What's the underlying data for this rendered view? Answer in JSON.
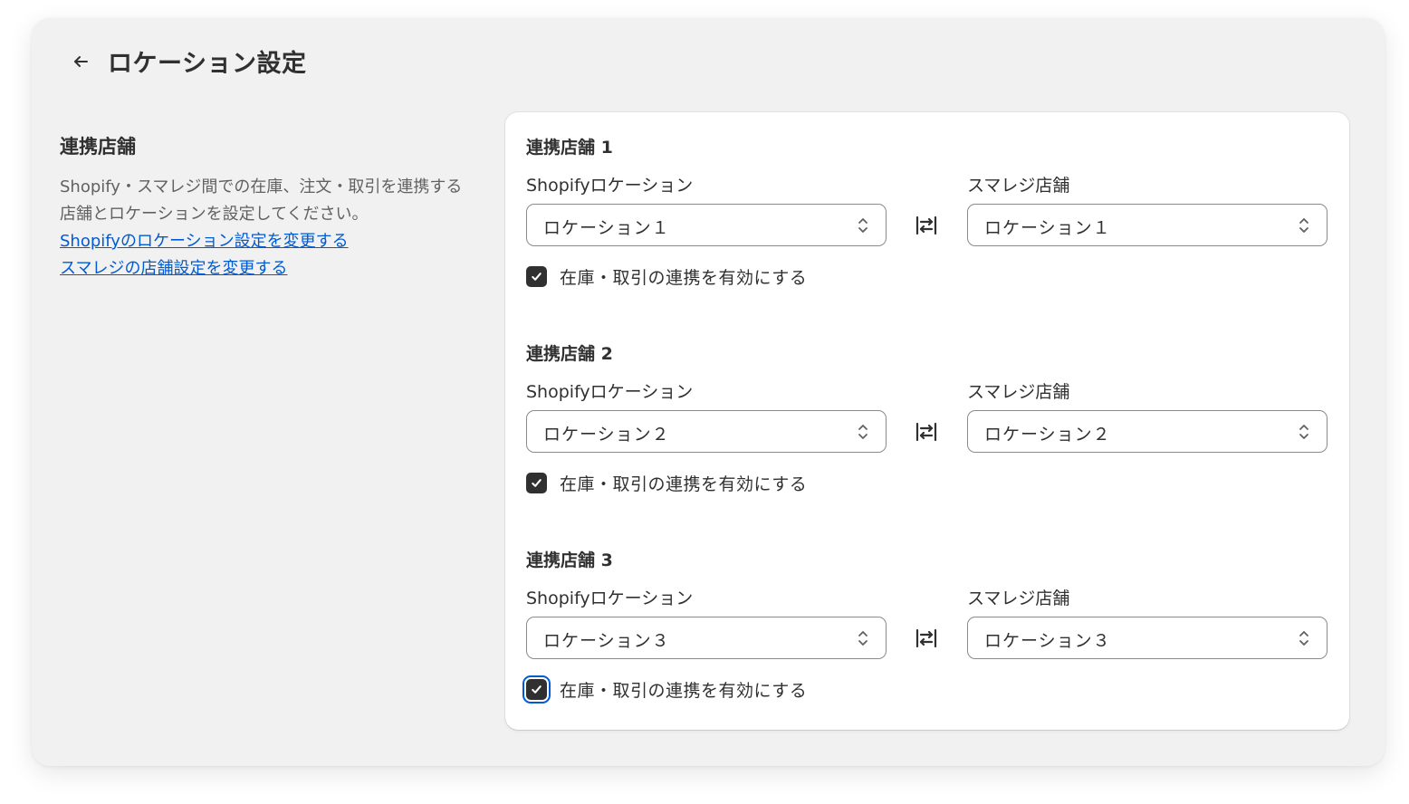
{
  "page": {
    "title": "ロケーション設定",
    "back_icon": "arrow-left-icon"
  },
  "left": {
    "title": "連携店舗",
    "description": "Shopify・スマレジ間での在庫、注文・取引を連携する店舗とロケーションを設定してください。",
    "links": [
      "Shopifyのロケーション設定を変更する",
      "スマレジの店舗設定を変更する"
    ]
  },
  "stores": [
    {
      "title": "連携店舗 1",
      "shopify_label": "Shopifyロケーション",
      "shopify_value": "ロケーション１",
      "smaregi_label": "スマレジ店舗",
      "smaregi_value": "ロケーション１",
      "checkbox_label": "在庫・取引の連携を有効にする",
      "checked": true
    },
    {
      "title": "連携店舗 2",
      "shopify_label": "Shopifyロケーション",
      "shopify_value": "ロケーション２",
      "smaregi_label": "スマレジ店舗",
      "smaregi_value": "ロケーション２",
      "checkbox_label": "在庫・取引の連携を有効にする",
      "checked": true
    },
    {
      "title": "連携店舗 3",
      "shopify_label": "Shopifyロケーション",
      "shopify_value": "ロケーション３",
      "smaregi_label": "スマレジ店舗",
      "smaregi_value": "ロケーション３",
      "checkbox_label": "在庫・取引の連携を有効にする",
      "checked": true,
      "focused": true
    }
  ],
  "colors": {
    "background": "#f1f1f1",
    "card": "#ffffff",
    "link": "#005bd3",
    "checkbox": "#303030",
    "focus_ring": "#005bd3"
  },
  "icons": {
    "swap": "arrows-swap-icon",
    "select": "chevron-up-down-icon",
    "check": "checkmark-icon"
  }
}
